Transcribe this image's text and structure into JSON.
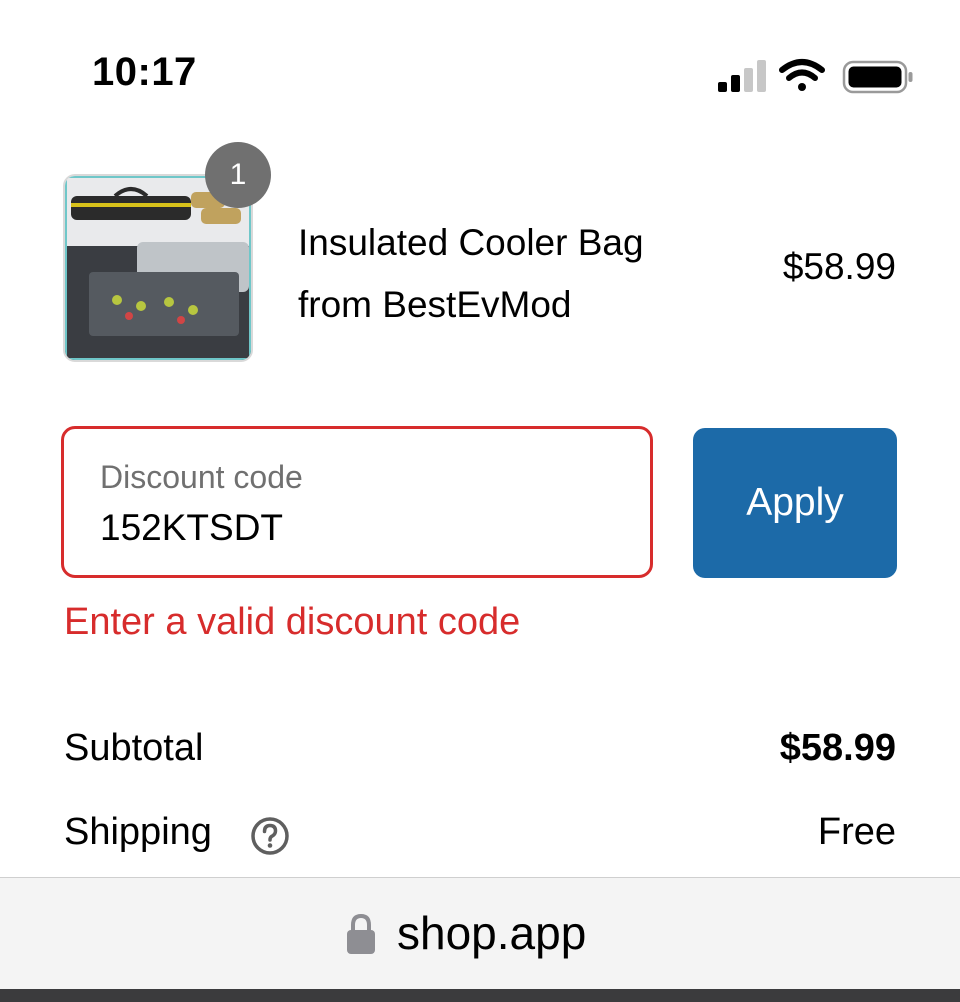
{
  "status_bar": {
    "time": "10:17",
    "icons": [
      "signal-icon",
      "wifi-icon",
      "battery-icon"
    ]
  },
  "product": {
    "name": "Insulated Cooler Bag from BestEvMod",
    "price": "$58.99",
    "quantity": "1"
  },
  "discount": {
    "label": "Discount code",
    "value": "152KTSDT",
    "apply_label": "Apply",
    "error": "Enter a valid discount code"
  },
  "totals": {
    "subtotal_label": "Subtotal",
    "subtotal_value": "$58.99",
    "shipping_label": "Shipping",
    "shipping_value": "Free"
  },
  "browser": {
    "url": "shop.app"
  },
  "colors": {
    "error": "#d72c2c",
    "button": "#1c6aa8",
    "badge": "#707070"
  }
}
